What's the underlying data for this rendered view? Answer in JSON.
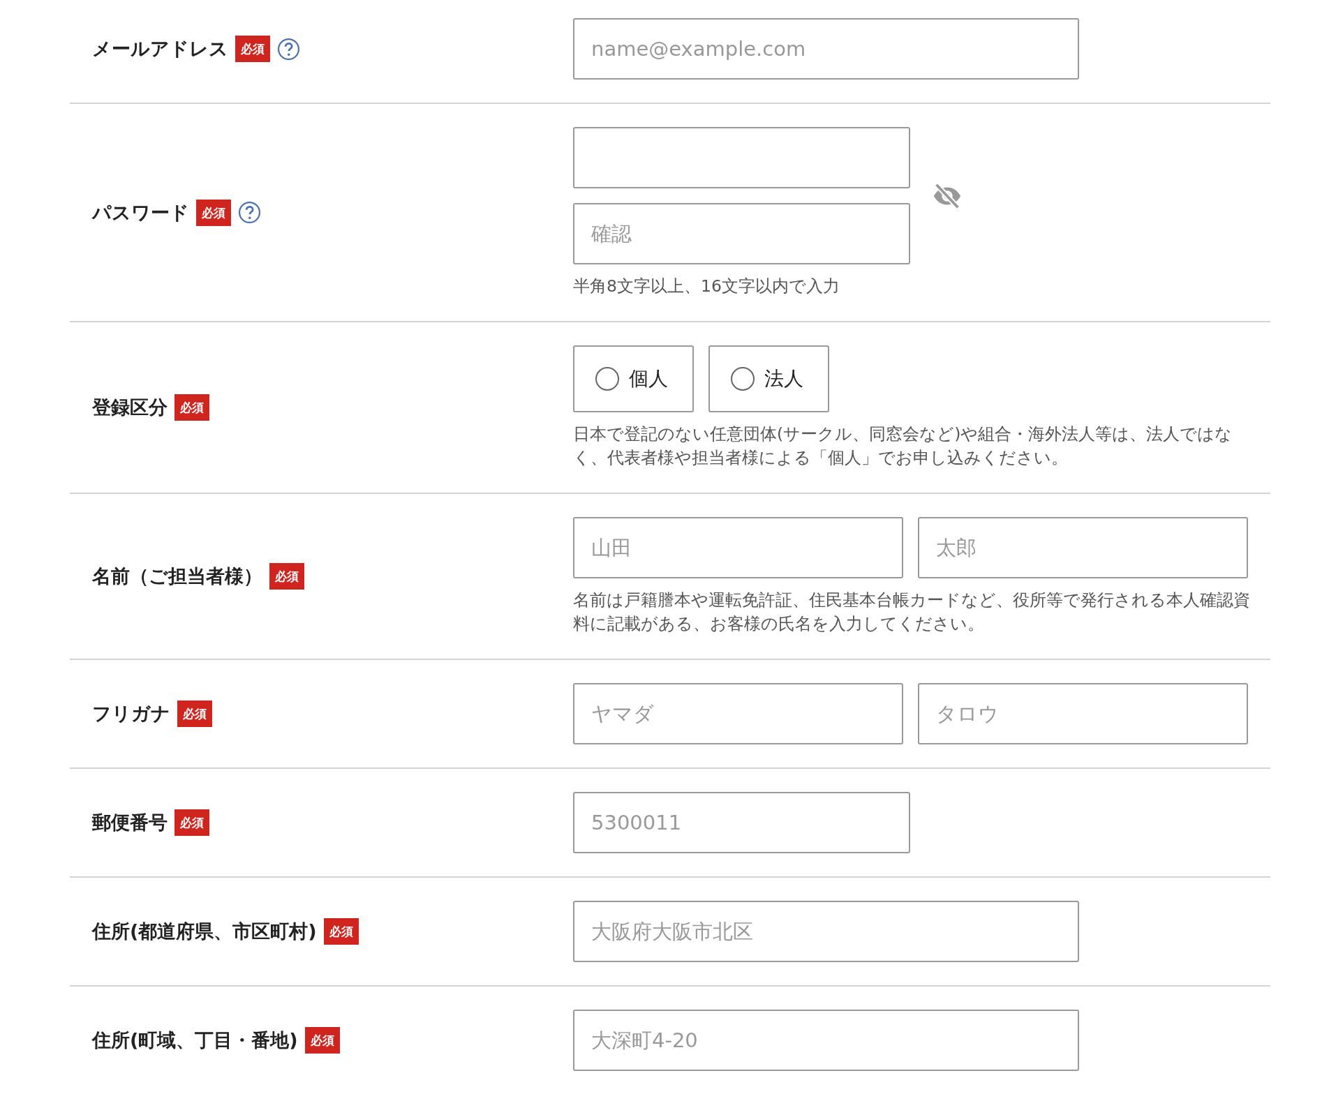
{
  "rows": [
    {
      "label": "メールアドレス",
      "badge": "必須",
      "help": true,
      "kind": "wide",
      "inputs": [
        {
          "placeholder": "name@example.com"
        }
      ]
    },
    {
      "label": "パスワード",
      "badge": "必須",
      "help": true,
      "kind": "password",
      "confirm_placeholder": "確認",
      "note": "半角8文字以上、16文字以内で入力"
    },
    {
      "label": "登録区分",
      "badge": "必須",
      "help": false,
      "kind": "radio",
      "options": [
        {
          "label": "個人",
          "selected": false
        },
        {
          "label": "法人",
          "selected": false
        }
      ],
      "note": "日本で登記のない任意団体(サークル、同窓会など)や組合・海外法人等は、法人ではなく、代表者様や担当者様による「個人」でお申し込みください。"
    },
    {
      "label": "名前（ご担当者様）",
      "badge": "必須",
      "help": false,
      "kind": "pair",
      "inputs": [
        {
          "placeholder": "山田"
        },
        {
          "placeholder": "太郎"
        }
      ],
      "note": "名前は戸籍謄本や運転免許証、住民基本台帳カードなど、役所等で発行される本人確認資料に記載がある、お客様の氏名を入力してください。"
    },
    {
      "label": "フリガナ",
      "badge": "必須",
      "help": false,
      "kind": "pair",
      "inputs": [
        {
          "placeholder": "ヤマダ"
        },
        {
          "placeholder": "タロウ"
        }
      ]
    },
    {
      "label": "郵便番号",
      "badge": "必須",
      "help": false,
      "kind": "narrow",
      "inputs": [
        {
          "placeholder": "5300011"
        }
      ]
    },
    {
      "label": "住所(都道府県、市区町村)",
      "badge": "必須",
      "help": false,
      "kind": "wide",
      "inputs": [
        {
          "placeholder": "大阪府大阪市北区"
        }
      ]
    },
    {
      "label": "住所(町域、丁目・番地)",
      "badge": "必須",
      "help": false,
      "kind": "wide",
      "inputs": [
        {
          "placeholder": "大深町4-20"
        }
      ]
    }
  ]
}
